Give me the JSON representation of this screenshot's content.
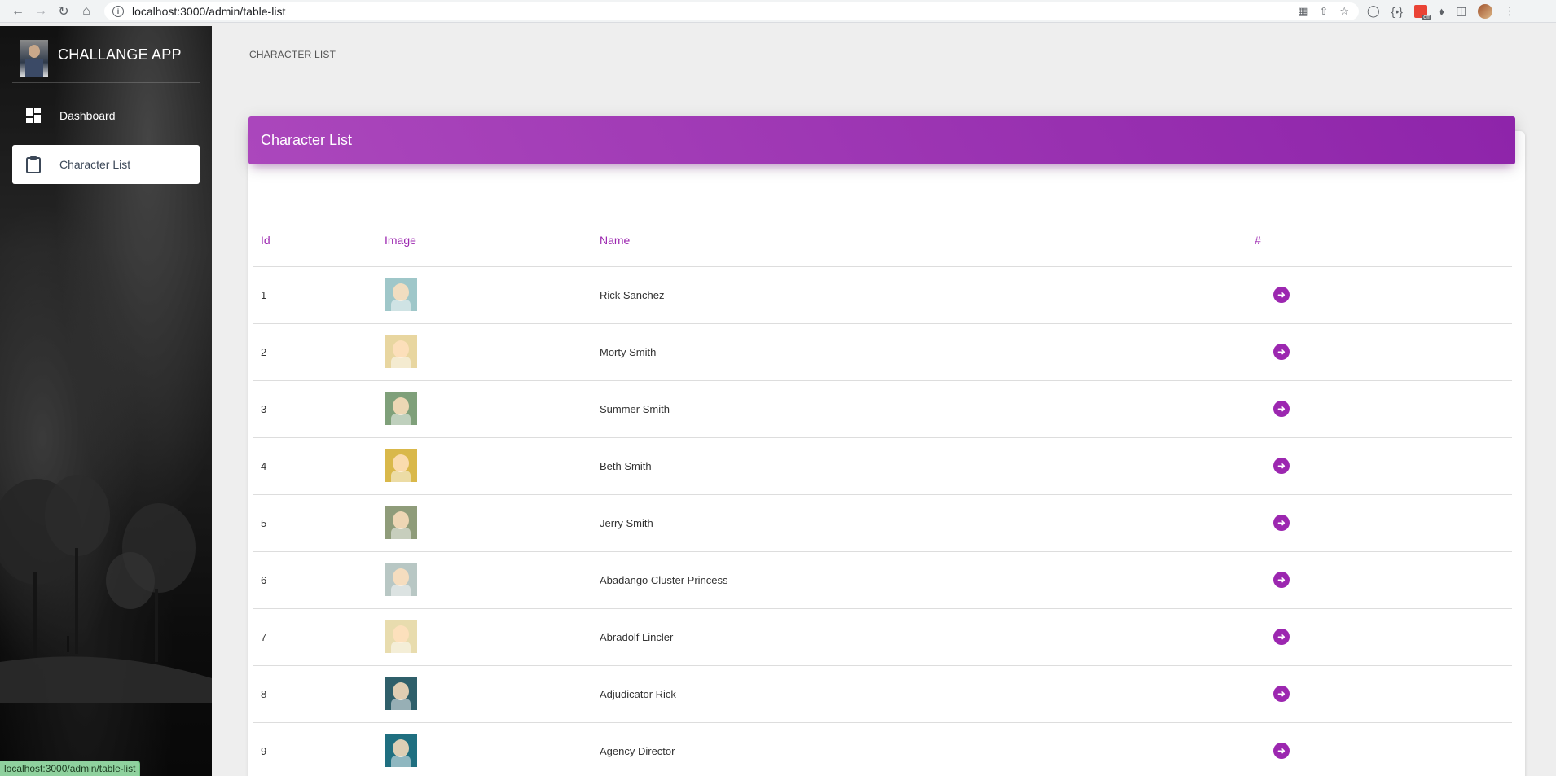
{
  "browser": {
    "url": "localhost:3000/admin/table-list",
    "status_url": "localhost:3000/admin/table-list",
    "ext_badge": "off"
  },
  "sidebar": {
    "brand": "CHALLANGE APP",
    "items": [
      {
        "label": "Dashboard",
        "icon": "dashboard-icon",
        "active": false
      },
      {
        "label": "Character List",
        "icon": "clipboard-icon",
        "active": true
      }
    ]
  },
  "main": {
    "page_heading": "CHARACTER LIST",
    "card_title": "Character List",
    "columns": [
      "Id",
      "Image",
      "Name",
      "#"
    ],
    "rows": [
      {
        "id": "1",
        "name": "Rick Sanchez",
        "thumb_color": "#9fc7c9"
      },
      {
        "id": "2",
        "name": "Morty Smith",
        "thumb_color": "#e8d6a0"
      },
      {
        "id": "3",
        "name": "Summer Smith",
        "thumb_color": "#7fa07a"
      },
      {
        "id": "4",
        "name": "Beth Smith",
        "thumb_color": "#d9b84a"
      },
      {
        "id": "5",
        "name": "Jerry Smith",
        "thumb_color": "#8f9c7a"
      },
      {
        "id": "6",
        "name": "Abadango Cluster Princess",
        "thumb_color": "#b8c7c4"
      },
      {
        "id": "7",
        "name": "Abradolf Lincler",
        "thumb_color": "#e8dcae"
      },
      {
        "id": "8",
        "name": "Adjudicator Rick",
        "thumb_color": "#2f5f6a"
      },
      {
        "id": "9",
        "name": "Agency Director",
        "thumb_color": "#1f6f80"
      }
    ]
  },
  "colors": {
    "accent": "#9c27b0",
    "header_gradient_start": "#ab47bc",
    "header_gradient_end": "#8e24aa"
  }
}
